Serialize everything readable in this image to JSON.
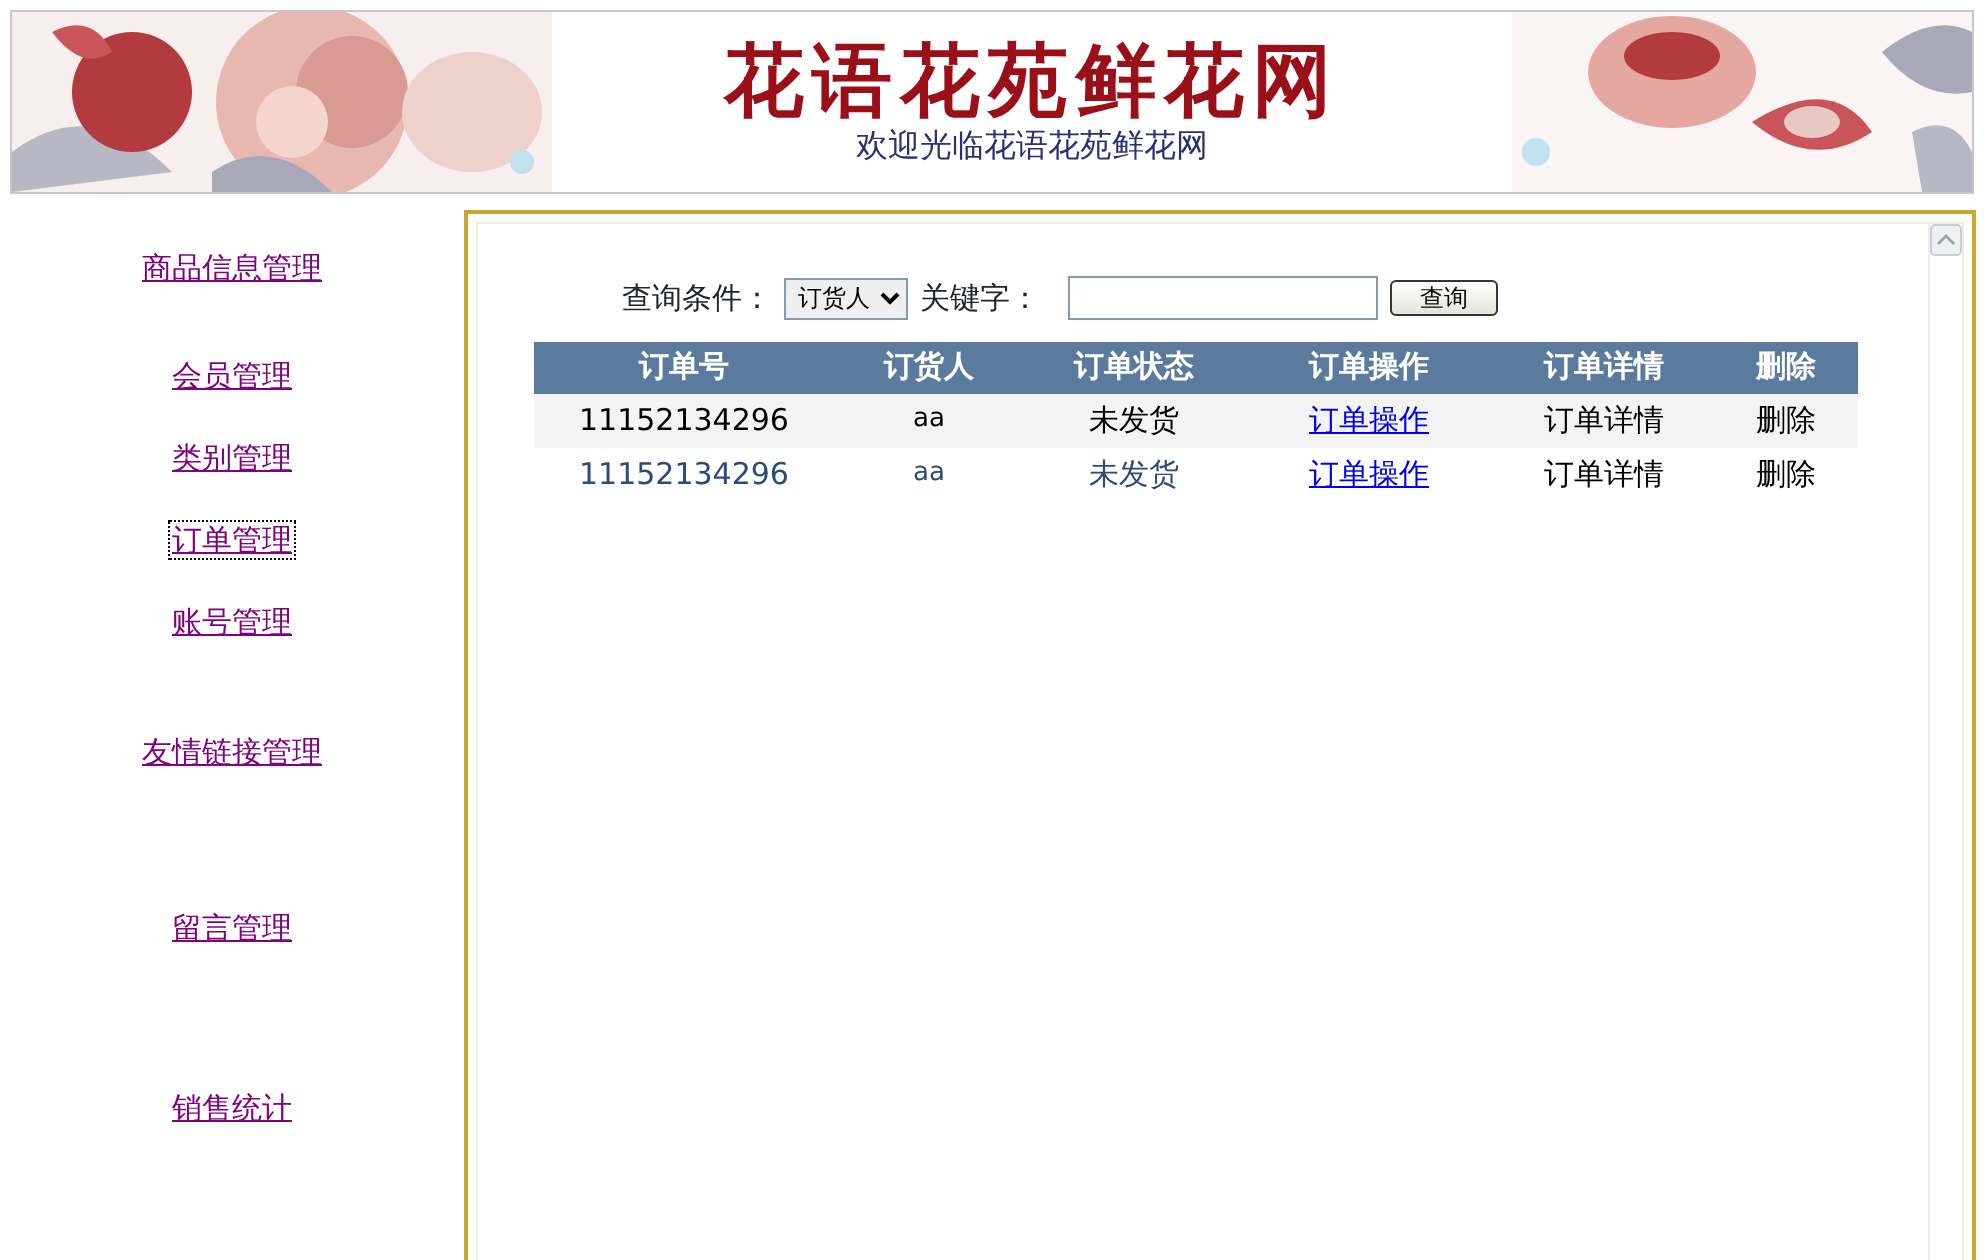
{
  "banner": {
    "title": "花语花苑鲜花网",
    "subtitle": "欢迎光临花语花苑鲜花网"
  },
  "sidebar": {
    "items": [
      {
        "label": "商品信息管理",
        "focused": false
      },
      {
        "label": "会员管理",
        "focused": false
      },
      {
        "label": "类别管理",
        "focused": false
      },
      {
        "label": "订单管理",
        "focused": true
      },
      {
        "label": "账号管理",
        "focused": false
      },
      {
        "label": "友情链接管理",
        "focused": false
      },
      {
        "label": "留言管理",
        "focused": false
      },
      {
        "label": "销售统计",
        "focused": false
      }
    ]
  },
  "search": {
    "label": "查询条件：",
    "select_value": "订货人",
    "keyword_label": "关键字：",
    "button": "查询"
  },
  "table": {
    "columns": [
      "订单号",
      "订货人",
      "订单状态",
      "订单操作",
      "订单详情",
      "删除"
    ],
    "rows": [
      {
        "shaded": true,
        "cells": [
          "11152134296",
          "aa",
          "未发货",
          "订单操作",
          "订单详情",
          "删除"
        ]
      },
      {
        "shaded": false,
        "cells": [
          "11152134296",
          "aa",
          "未发货",
          "订单操作",
          "订单详情",
          "删除"
        ]
      }
    ]
  }
}
